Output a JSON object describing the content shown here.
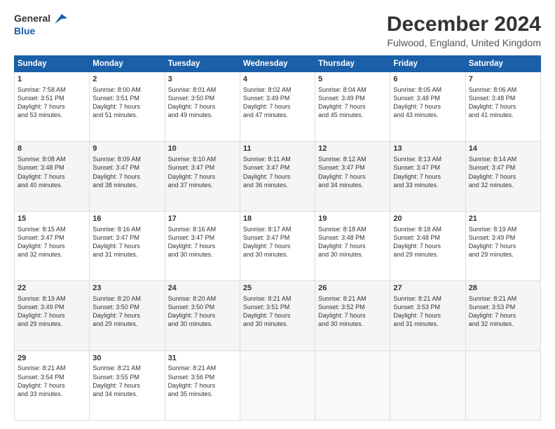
{
  "header": {
    "logo_line1": "General",
    "logo_line2": "Blue",
    "title": "December 2024",
    "subtitle": "Fulwood, England, United Kingdom"
  },
  "columns": [
    "Sunday",
    "Monday",
    "Tuesday",
    "Wednesday",
    "Thursday",
    "Friday",
    "Saturday"
  ],
  "weeks": [
    [
      {
        "day": "1",
        "lines": [
          "Sunrise: 7:58 AM",
          "Sunset: 3:51 PM",
          "Daylight: 7 hours",
          "and 53 minutes."
        ]
      },
      {
        "day": "2",
        "lines": [
          "Sunrise: 8:00 AM",
          "Sunset: 3:51 PM",
          "Daylight: 7 hours",
          "and 51 minutes."
        ]
      },
      {
        "day": "3",
        "lines": [
          "Sunrise: 8:01 AM",
          "Sunset: 3:50 PM",
          "Daylight: 7 hours",
          "and 49 minutes."
        ]
      },
      {
        "day": "4",
        "lines": [
          "Sunrise: 8:02 AM",
          "Sunset: 3:49 PM",
          "Daylight: 7 hours",
          "and 47 minutes."
        ]
      },
      {
        "day": "5",
        "lines": [
          "Sunrise: 8:04 AM",
          "Sunset: 3:49 PM",
          "Daylight: 7 hours",
          "and 45 minutes."
        ]
      },
      {
        "day": "6",
        "lines": [
          "Sunrise: 8:05 AM",
          "Sunset: 3:48 PM",
          "Daylight: 7 hours",
          "and 43 minutes."
        ]
      },
      {
        "day": "7",
        "lines": [
          "Sunrise: 8:06 AM",
          "Sunset: 3:48 PM",
          "Daylight: 7 hours",
          "and 41 minutes."
        ]
      }
    ],
    [
      {
        "day": "8",
        "lines": [
          "Sunrise: 8:08 AM",
          "Sunset: 3:48 PM",
          "Daylight: 7 hours",
          "and 40 minutes."
        ]
      },
      {
        "day": "9",
        "lines": [
          "Sunrise: 8:09 AM",
          "Sunset: 3:47 PM",
          "Daylight: 7 hours",
          "and 38 minutes."
        ]
      },
      {
        "day": "10",
        "lines": [
          "Sunrise: 8:10 AM",
          "Sunset: 3:47 PM",
          "Daylight: 7 hours",
          "and 37 minutes."
        ]
      },
      {
        "day": "11",
        "lines": [
          "Sunrise: 8:11 AM",
          "Sunset: 3:47 PM",
          "Daylight: 7 hours",
          "and 36 minutes."
        ]
      },
      {
        "day": "12",
        "lines": [
          "Sunrise: 8:12 AM",
          "Sunset: 3:47 PM",
          "Daylight: 7 hours",
          "and 34 minutes."
        ]
      },
      {
        "day": "13",
        "lines": [
          "Sunrise: 8:13 AM",
          "Sunset: 3:47 PM",
          "Daylight: 7 hours",
          "and 33 minutes."
        ]
      },
      {
        "day": "14",
        "lines": [
          "Sunrise: 8:14 AM",
          "Sunset: 3:47 PM",
          "Daylight: 7 hours",
          "and 32 minutes."
        ]
      }
    ],
    [
      {
        "day": "15",
        "lines": [
          "Sunrise: 8:15 AM",
          "Sunset: 3:47 PM",
          "Daylight: 7 hours",
          "and 32 minutes."
        ]
      },
      {
        "day": "16",
        "lines": [
          "Sunrise: 8:16 AM",
          "Sunset: 3:47 PM",
          "Daylight: 7 hours",
          "and 31 minutes."
        ]
      },
      {
        "day": "17",
        "lines": [
          "Sunrise: 8:16 AM",
          "Sunset: 3:47 PM",
          "Daylight: 7 hours",
          "and 30 minutes."
        ]
      },
      {
        "day": "18",
        "lines": [
          "Sunrise: 8:17 AM",
          "Sunset: 3:47 PM",
          "Daylight: 7 hours",
          "and 30 minutes."
        ]
      },
      {
        "day": "19",
        "lines": [
          "Sunrise: 8:18 AM",
          "Sunset: 3:48 PM",
          "Daylight: 7 hours",
          "and 30 minutes."
        ]
      },
      {
        "day": "20",
        "lines": [
          "Sunrise: 8:18 AM",
          "Sunset: 3:48 PM",
          "Daylight: 7 hours",
          "and 29 minutes."
        ]
      },
      {
        "day": "21",
        "lines": [
          "Sunrise: 8:19 AM",
          "Sunset: 3:49 PM",
          "Daylight: 7 hours",
          "and 29 minutes."
        ]
      }
    ],
    [
      {
        "day": "22",
        "lines": [
          "Sunrise: 8:19 AM",
          "Sunset: 3:49 PM",
          "Daylight: 7 hours",
          "and 29 minutes."
        ]
      },
      {
        "day": "23",
        "lines": [
          "Sunrise: 8:20 AM",
          "Sunset: 3:50 PM",
          "Daylight: 7 hours",
          "and 29 minutes."
        ]
      },
      {
        "day": "24",
        "lines": [
          "Sunrise: 8:20 AM",
          "Sunset: 3:50 PM",
          "Daylight: 7 hours",
          "and 30 minutes."
        ]
      },
      {
        "day": "25",
        "lines": [
          "Sunrise: 8:21 AM",
          "Sunset: 3:51 PM",
          "Daylight: 7 hours",
          "and 30 minutes."
        ]
      },
      {
        "day": "26",
        "lines": [
          "Sunrise: 8:21 AM",
          "Sunset: 3:52 PM",
          "Daylight: 7 hours",
          "and 30 minutes."
        ]
      },
      {
        "day": "27",
        "lines": [
          "Sunrise: 8:21 AM",
          "Sunset: 3:53 PM",
          "Daylight: 7 hours",
          "and 31 minutes."
        ]
      },
      {
        "day": "28",
        "lines": [
          "Sunrise: 8:21 AM",
          "Sunset: 3:53 PM",
          "Daylight: 7 hours",
          "and 32 minutes."
        ]
      }
    ],
    [
      {
        "day": "29",
        "lines": [
          "Sunrise: 8:21 AM",
          "Sunset: 3:54 PM",
          "Daylight: 7 hours",
          "and 33 minutes."
        ]
      },
      {
        "day": "30",
        "lines": [
          "Sunrise: 8:21 AM",
          "Sunset: 3:55 PM",
          "Daylight: 7 hours",
          "and 34 minutes."
        ]
      },
      {
        "day": "31",
        "lines": [
          "Sunrise: 8:21 AM",
          "Sunset: 3:56 PM",
          "Daylight: 7 hours",
          "and 35 minutes."
        ]
      },
      null,
      null,
      null,
      null
    ]
  ]
}
